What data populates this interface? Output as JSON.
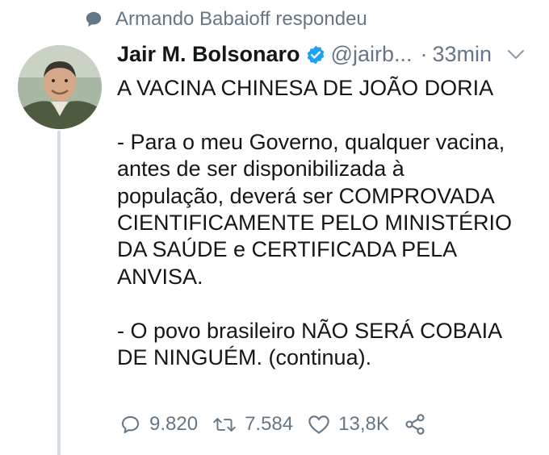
{
  "context": {
    "icon": "speech-bubble-icon",
    "text": "Armando Babaioff respondeu"
  },
  "tweet": {
    "author_name": "Jair M. Bolsonaro",
    "handle": "@jairb...",
    "separator": "·",
    "time": "33min",
    "verified": true,
    "lines": [
      "A VACINA CHINESA DE JOÃO DORIA",
      "",
      "- Para o meu Governo, qualquer vacina,",
      "antes de ser disponibilizada à",
      "população, deverá ser COMPROVADA",
      "CIENTIFICAMENTE PELO MINISTÉRIO",
      "DA SAÚDE e CERTIFICADA PELA",
      "ANVISA.",
      "",
      "- O povo brasileiro NÃO SERÁ COBAIA",
      "DE NINGUÉM. (continua)."
    ]
  },
  "actions": {
    "replies": "9.820",
    "retweets": "7.584",
    "likes": "13,8K"
  },
  "colors": {
    "text": "#14171a",
    "secondary": "#657786",
    "verified": "#1da1f2",
    "thread_line": "#d3dce3"
  }
}
